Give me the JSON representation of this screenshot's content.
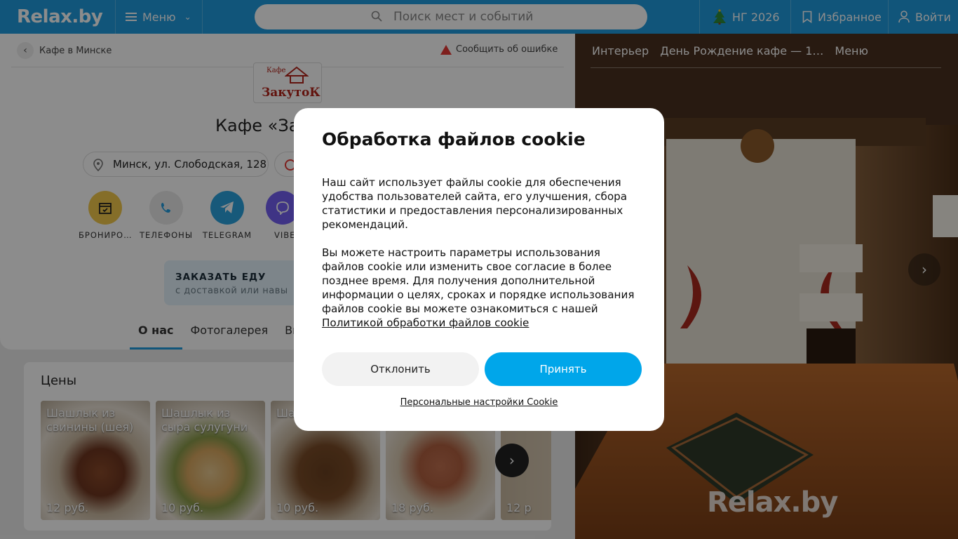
{
  "header": {
    "logo": "Relax.by",
    "menu_label": "Меню",
    "search_placeholder": "Поиск мест и событий",
    "ng_label": "НГ 2026",
    "favorites_label": "Избранное",
    "login_label": "Войти"
  },
  "breadcrumb": {
    "back_label": "Кафе в Минске"
  },
  "report_label": "Сообщить об ошибке",
  "cafe": {
    "logo_small": "Кафе",
    "logo_big": "ЗакутоК",
    "title": "Кафе «За",
    "address": "Минск, ул. Слободская, 128"
  },
  "actions": [
    {
      "label": "БРОНИРО…",
      "icon": "calendar-icon"
    },
    {
      "label": "ТЕЛЕФОНЫ",
      "icon": "phone-icon"
    },
    {
      "label": "TELEGRAM",
      "icon": "telegram-icon"
    },
    {
      "label": "VIBE",
      "icon": "viber-icon"
    }
  ],
  "order": {
    "title": "ЗАКАЗАТЬ ЕДУ",
    "subtitle": "с доставкой или навы"
  },
  "tabs": [
    {
      "label": "О нас",
      "active": true
    },
    {
      "label": "Фотогалерея",
      "active": false
    },
    {
      "label": "Ви",
      "active": false
    }
  ],
  "prices": {
    "title": "Цены",
    "items": [
      {
        "name": "Шашлык из свинины (шея)",
        "price": "12 руб."
      },
      {
        "name": "Шашлык из сыра сулугуни",
        "price": "10 руб."
      },
      {
        "name": "Шаш шам",
        "price": "10 руб."
      },
      {
        "name": "",
        "price": "18 руб."
      },
      {
        "name": "",
        "price": "12 р"
      }
    ]
  },
  "photo": {
    "tabs": [
      "Интерьер",
      "День Рождение кафе — 1…",
      "Меню"
    ],
    "watermark": "Relax.by"
  },
  "cookie": {
    "title": "Обработка файлов cookie",
    "paragraph1": "Наш сайт использует файлы cookie для обеспечения удобства пользователей сайта, его улучшения, сбора статистики и предоставления персонализированных рекомендаций.",
    "paragraph2": "Вы можете настроить параметры использования файлов cookie или изменить свое согласие в более позднее время. Для получения дополнительной информации о целях, сроках и порядке использования файлов cookie вы можете ознакомиться с нашей",
    "policy_link": "Политикой обработки файлов cookie",
    "decline_label": "Отклонить",
    "accept_label": "Принять",
    "settings_link": "Персональные настройки Cookie"
  },
  "colors": {
    "header_bg": "#1f9bde",
    "accept_bg": "#00a6ea",
    "accent_tab": "#1f9bde"
  }
}
